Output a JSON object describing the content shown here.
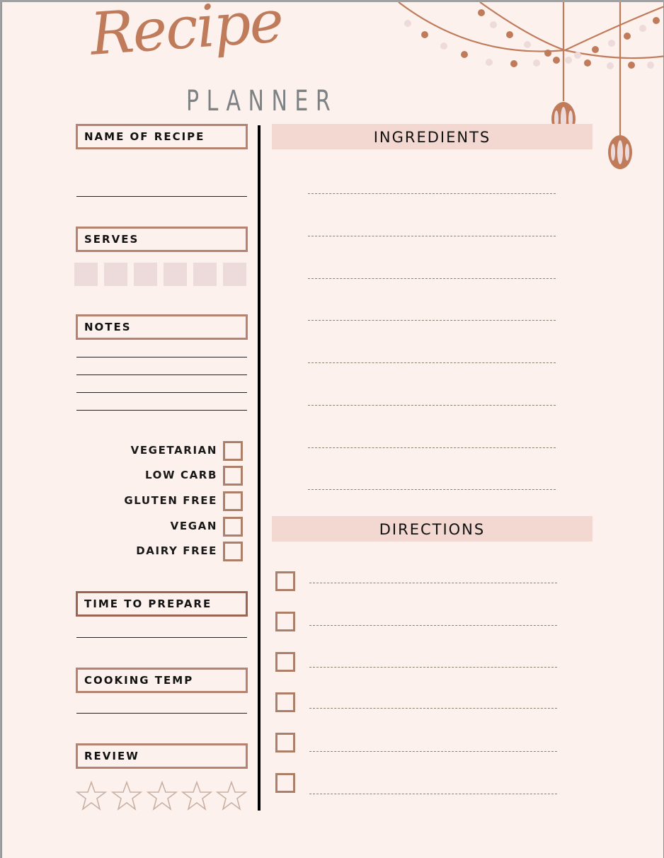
{
  "header": {
    "title_script": "Recipe",
    "title_sub": "PLANNER"
  },
  "colors": {
    "background": "#fdf1ee",
    "accent": "#c07b5b",
    "label_border": "#b58370",
    "section_bar": "#f2d8d1",
    "serve_box": "#eddadb",
    "subtitle": "#7d8285"
  },
  "left": {
    "name_of_recipe": "NAME OF RECIPE",
    "serves": "SERVES",
    "serves_boxes": 6,
    "notes": "NOTES",
    "notes_lines": 4,
    "diet_options": [
      {
        "label": "VEGETARIAN",
        "checked": false
      },
      {
        "label": "LOW CARB",
        "checked": false
      },
      {
        "label": "GLUTEN FREE",
        "checked": false
      },
      {
        "label": "VEGAN",
        "checked": false
      },
      {
        "label": "DAIRY FREE",
        "checked": false
      }
    ],
    "time_to_prepare": "TIME TO PREPARE",
    "cooking_temp": "COOKING TEMP",
    "review": "REVIEW",
    "review_stars_total": 5,
    "review_stars_filled": 0
  },
  "right": {
    "ingredients_title": "INGREDIENTS",
    "ingredient_lines": 8,
    "directions_title": "DIRECTIONS",
    "direction_steps": 6
  },
  "icons": {
    "decoration": "string-lights-lanterns-icon",
    "star": "star-outline-icon",
    "checkbox": "checkbox-empty-icon"
  }
}
